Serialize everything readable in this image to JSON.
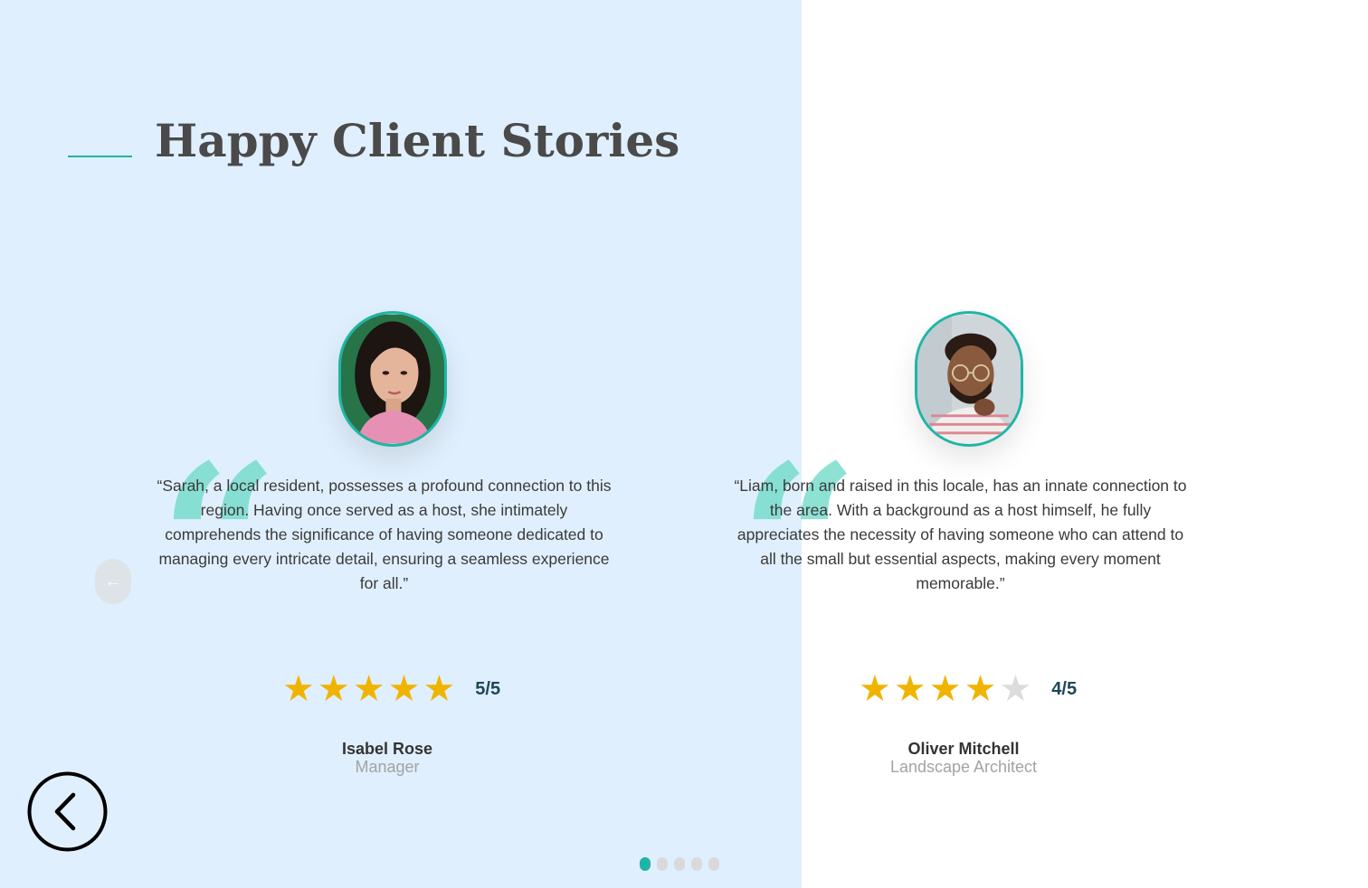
{
  "section": {
    "title": "Happy Client Stories",
    "accent_color": "#1fb5a6",
    "left_panel_color": "#e0effd"
  },
  "testimonials": [
    {
      "quote": "“Sarah, a local resident, possesses a profound connection to this region. Having once served as a host, she intimately comprehends the significance of having someone dedicated to managing every intricate detail, ensuring a seamless experience for all.”",
      "rating": 5,
      "rating_label": "5/5",
      "name": "Isabel Rose",
      "role": "Manager"
    },
    {
      "quote": "“Liam, born and raised in this locale, has an innate connection to the area. With a background as a host himself, he fully appreciates the necessity of having someone who can attend to all the small but essential aspects, making every moment memorable.”",
      "rating": 4,
      "rating_label": "4/5",
      "name": "Oliver Mitchell",
      "role": "Landscape Architect"
    }
  ],
  "icons": {
    "quote": "quote-icon",
    "prev": "arrow-left-icon",
    "back": "chevron-left-circle-icon"
  },
  "pagination": {
    "total": 5,
    "active": 1
  }
}
